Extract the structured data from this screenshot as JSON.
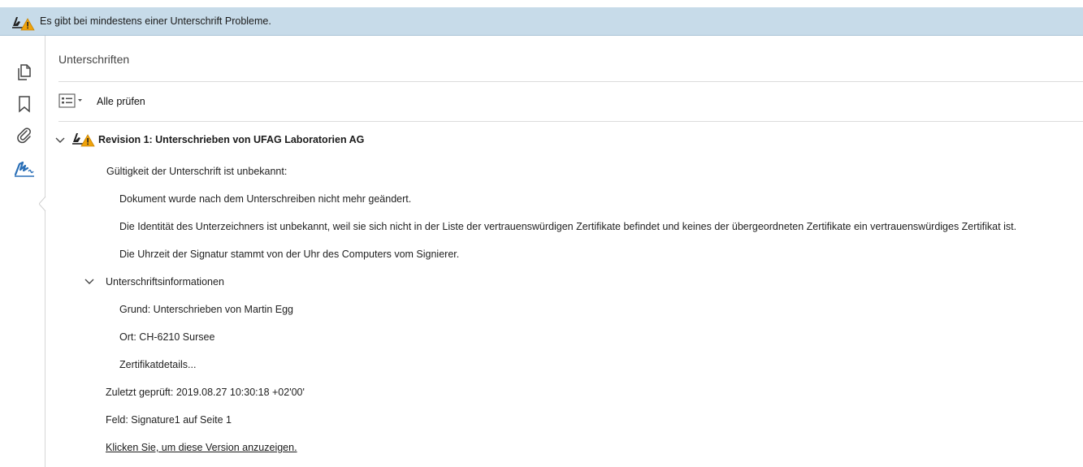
{
  "banner": {
    "message": "Es gibt bei mindestens einer Unterschrift Probleme."
  },
  "rail": {
    "icons": [
      "pages-icon",
      "bookmark-icon",
      "attachment-icon",
      "signature-icon"
    ],
    "active": "signature-icon"
  },
  "panel": {
    "title": "Unterschriften",
    "toolbar": {
      "validate_all_label": "Alle prüfen"
    }
  },
  "revision": {
    "title": "Revision 1: Unterschrieben von UFAG Laboratorien AG",
    "validity_heading": "Gültigkeit der Unterschrift ist unbekannt:",
    "validity_details": [
      "Dokument wurde nach dem Unterschreiben nicht mehr geändert.",
      "Die Identität des Unterzeichners ist unbekannt, weil sie sich nicht in der Liste der vertrauenswürdigen Zertifikate befindet und keines der übergeordneten Zertifikate ein vertrauenswürdiges Zertifikat ist.",
      "Die Uhrzeit der Signatur stammt von der Uhr des Computers vom Signierer."
    ],
    "info_heading": "Unterschriftsinformationen",
    "info_items": [
      "Grund: Unterschrieben von Martin Egg",
      "Ort: CH-6210 Sursee",
      "Zertifikatdetails..."
    ],
    "last_checked": "Zuletzt geprüft: 2019.08.27 10:30:18 +02'00'",
    "field": "Feld: Signature1 auf Seite 1",
    "view_version_link": "Klicken Sie, um diese Version anzuzeigen."
  },
  "colors": {
    "banner_bg": "#c7dbe9",
    "warning": "#f0a30a",
    "active_icon": "#2a6fb7"
  }
}
